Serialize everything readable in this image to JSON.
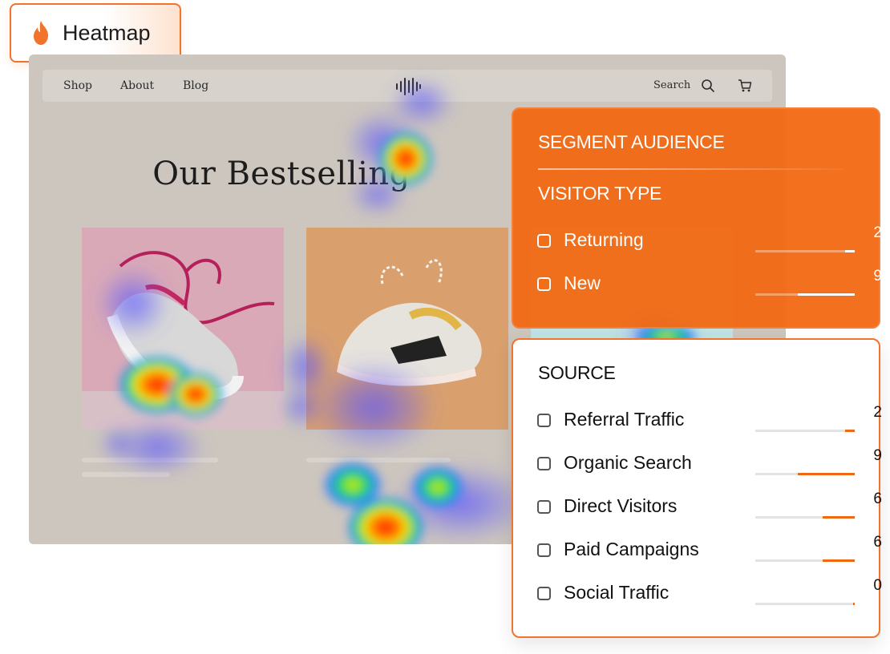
{
  "badge": {
    "label": "Heatmap",
    "icon": "flame-icon",
    "color": "#f0742b"
  },
  "site": {
    "nav": {
      "links": [
        "Shop",
        "About",
        "Blog"
      ],
      "search_label": "Search"
    },
    "hero_title": "Our Bestselling"
  },
  "segment_panel": {
    "title": "SEGMENT AUDIENCE",
    "visitor_type": {
      "heading": "VISITOR TYPE",
      "items": [
        {
          "label": "Returning",
          "count": "2",
          "share": 0.1
        },
        {
          "label": "New",
          "count": "9",
          "share": 0.57
        }
      ]
    },
    "color": "#f16812"
  },
  "source_panel": {
    "heading": "SOURCE",
    "items": [
      {
        "label": "Referral Traffic",
        "count": "2",
        "share": 0.1
      },
      {
        "label": "Organic Search",
        "count": "9",
        "share": 0.57
      },
      {
        "label": "Direct Visitors",
        "count": "6",
        "share": 0.32
      },
      {
        "label": "Paid Campaigns",
        "count": "6",
        "share": 0.32
      },
      {
        "label": "Social Traffic",
        "count": "0",
        "share": 0.02
      }
    ]
  }
}
